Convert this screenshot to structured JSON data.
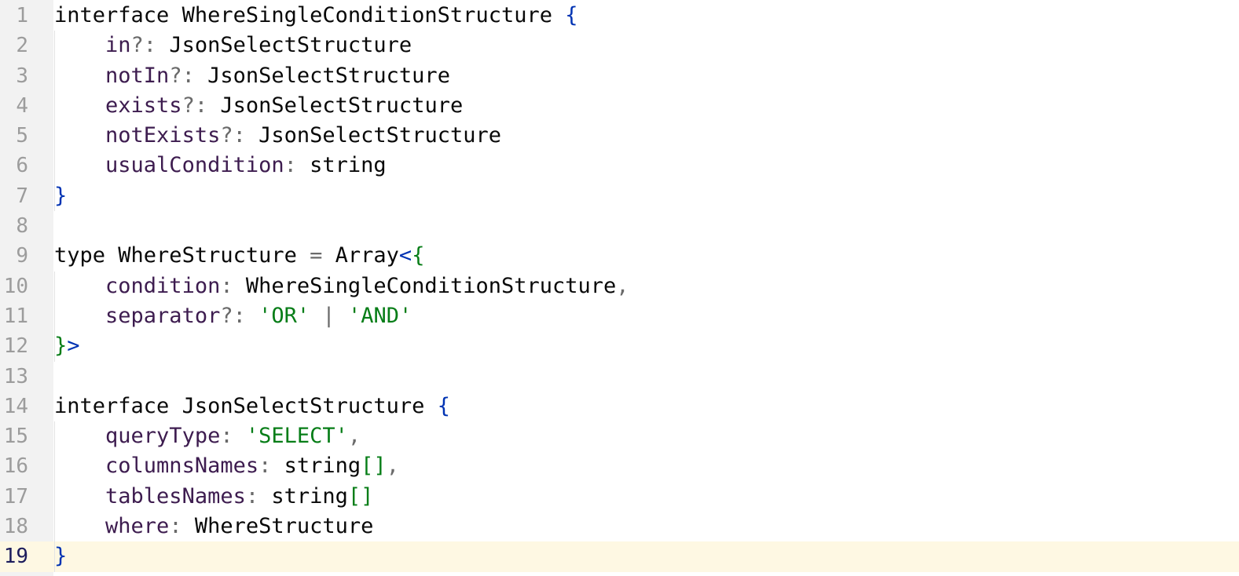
{
  "editor": {
    "current_line": 19,
    "lines": [
      {
        "num": "1",
        "tokens": [
          [
            "kw",
            "interface"
          ],
          [
            "type",
            " WhereSingleConditionStructure "
          ],
          [
            "brace",
            "{"
          ]
        ]
      },
      {
        "num": "2",
        "tokens": [
          [
            "type",
            "    "
          ],
          [
            "prop",
            "in"
          ],
          [
            "punc",
            "?: "
          ],
          [
            "type",
            "JsonSelectStructure"
          ]
        ]
      },
      {
        "num": "3",
        "tokens": [
          [
            "type",
            "    "
          ],
          [
            "prop",
            "notIn"
          ],
          [
            "punc",
            "?: "
          ],
          [
            "type",
            "JsonSelectStructure"
          ]
        ]
      },
      {
        "num": "4",
        "tokens": [
          [
            "type",
            "    "
          ],
          [
            "prop",
            "exists"
          ],
          [
            "punc",
            "?: "
          ],
          [
            "type",
            "JsonSelectStructure"
          ]
        ]
      },
      {
        "num": "5",
        "tokens": [
          [
            "type",
            "    "
          ],
          [
            "prop",
            "notExists"
          ],
          [
            "punc",
            "?: "
          ],
          [
            "type",
            "JsonSelectStructure"
          ]
        ]
      },
      {
        "num": "6",
        "tokens": [
          [
            "type",
            "    "
          ],
          [
            "prop",
            "usualCondition"
          ],
          [
            "punc",
            ": "
          ],
          [
            "type",
            "string"
          ]
        ]
      },
      {
        "num": "7",
        "tokens": [
          [
            "brace",
            "}"
          ]
        ]
      },
      {
        "num": "8",
        "tokens": []
      },
      {
        "num": "9",
        "tokens": [
          [
            "kw",
            "type"
          ],
          [
            "type",
            " WhereStructure "
          ],
          [
            "punc",
            "= "
          ],
          [
            "type",
            "Array"
          ],
          [
            "angle",
            "<"
          ],
          [
            "gbrace",
            "{"
          ]
        ]
      },
      {
        "num": "10",
        "tokens": [
          [
            "type",
            "    "
          ],
          [
            "prop",
            "condition"
          ],
          [
            "punc",
            ": "
          ],
          [
            "type",
            "WhereSingleConditionStructure"
          ],
          [
            "punc",
            ","
          ]
        ]
      },
      {
        "num": "11",
        "tokens": [
          [
            "type",
            "    "
          ],
          [
            "prop",
            "separator"
          ],
          [
            "punc",
            "?: "
          ],
          [
            "str",
            "'OR'"
          ],
          [
            "pipe",
            " | "
          ],
          [
            "str",
            "'AND'"
          ]
        ]
      },
      {
        "num": "12",
        "tokens": [
          [
            "gbrace",
            "}"
          ],
          [
            "angle",
            ">"
          ]
        ]
      },
      {
        "num": "13",
        "tokens": []
      },
      {
        "num": "14",
        "tokens": [
          [
            "kw",
            "interface"
          ],
          [
            "type",
            " JsonSelectStructure "
          ],
          [
            "brace",
            "{"
          ]
        ]
      },
      {
        "num": "15",
        "tokens": [
          [
            "type",
            "    "
          ],
          [
            "prop",
            "queryType"
          ],
          [
            "punc",
            ": "
          ],
          [
            "str",
            "'SELECT'"
          ],
          [
            "punc",
            ","
          ]
        ]
      },
      {
        "num": "16",
        "tokens": [
          [
            "type",
            "    "
          ],
          [
            "prop",
            "columnsNames"
          ],
          [
            "punc",
            ": "
          ],
          [
            "type",
            "string"
          ],
          [
            "gbrace",
            "[]"
          ],
          [
            "punc",
            ","
          ]
        ]
      },
      {
        "num": "17",
        "tokens": [
          [
            "type",
            "    "
          ],
          [
            "prop",
            "tablesNames"
          ],
          [
            "punc",
            ": "
          ],
          [
            "type",
            "string"
          ],
          [
            "gbrace",
            "[]"
          ]
        ]
      },
      {
        "num": "18",
        "tokens": [
          [
            "type",
            "    "
          ],
          [
            "prop",
            "where"
          ],
          [
            "punc",
            ": "
          ],
          [
            "type",
            "WhereStructure"
          ]
        ]
      },
      {
        "num": "19",
        "tokens": [
          [
            "brace",
            "}"
          ]
        ]
      }
    ]
  }
}
